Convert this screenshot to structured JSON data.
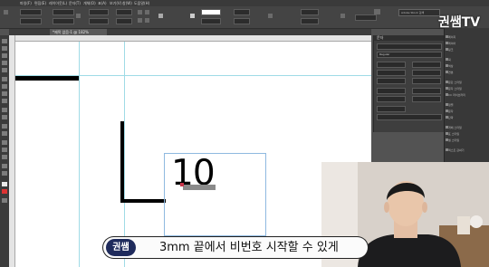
{
  "app": {
    "menu_items": [
      "파일(F)",
      "편집(E)",
      "레이아웃(L)",
      "문자(T)",
      "개체(O)",
      "표(A)",
      "보기(V)",
      "창(W)",
      "도움말(H)"
    ],
    "search_placeholder": "Adobe Stock 검색",
    "document_tab": "*제목 없음-1 @ 182%"
  },
  "control": {
    "x": "0 mm",
    "y": "0 mm",
    "w": "0 mm",
    "h": "0 mm",
    "zoom": "100%",
    "stroke": "0 pt"
  },
  "canvas": {
    "frame_text": "10"
  },
  "panel": {
    "title": "문자",
    "font_family": "Regular"
  },
  "dock": {
    "items": [
      "페이지",
      "레이어",
      "링크",
      "획",
      "색상",
      "견본",
      "문단 스타일",
      "문자 스타일",
      "CC 라이브러리",
      "정렬",
      "문자",
      "단락",
      "개체 스타일",
      "표 스타일",
      "셀 스타일",
      "텍스트 감싸기"
    ]
  },
  "overlay": {
    "brand": "권쌤TV",
    "speaker": "권쌤",
    "subtitle": "3mm 끝에서 비번호 시작할 수 있게"
  },
  "colors": {
    "guide": "#9fdbe6",
    "frame": "#8fb9e0",
    "speaker_badge": "#1f2b5c"
  }
}
